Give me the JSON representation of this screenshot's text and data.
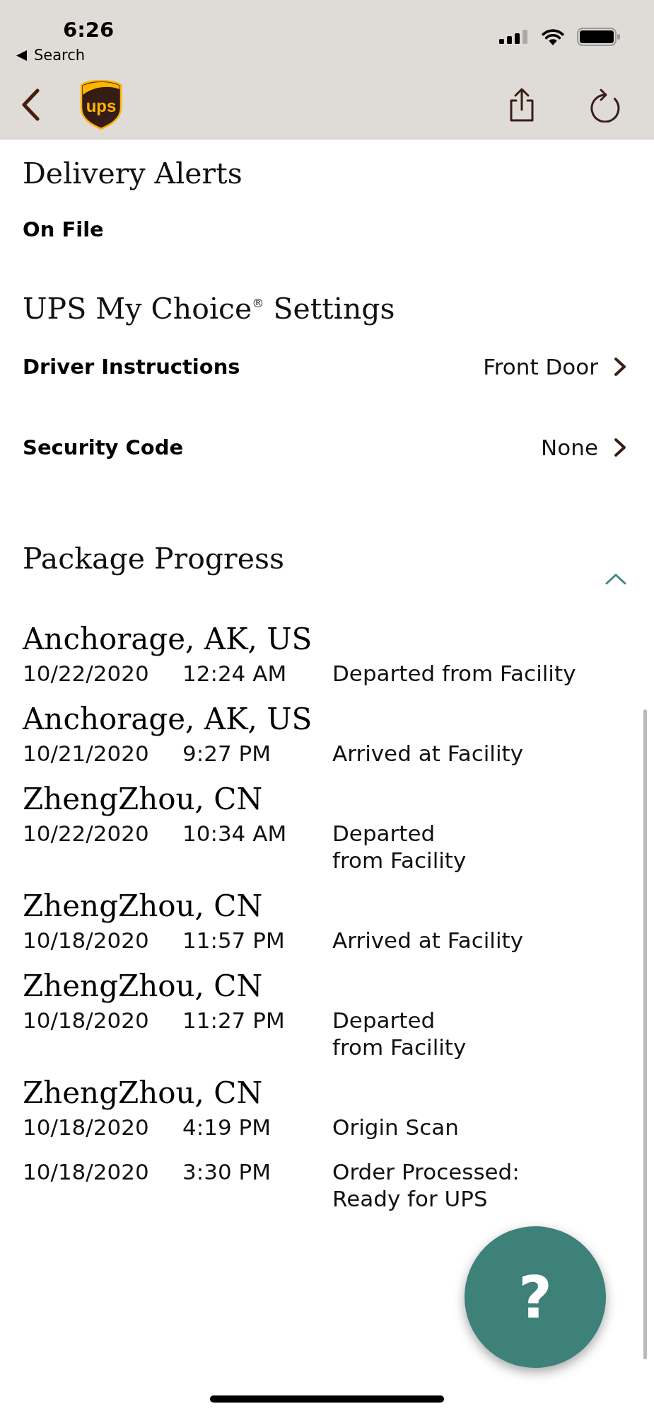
{
  "status_bar": {
    "time": "6:26",
    "back_label": "Search"
  },
  "nav_bar": {
    "logo_text": "ups"
  },
  "delivery_alerts": {
    "title": "Delivery Alerts",
    "value": "On File"
  },
  "my_choice_settings": {
    "title": "UPS My Choice$^{®}$ Settings",
    "rows": [
      {
        "label": "Driver Instructions",
        "value": "Front Door"
      },
      {
        "label": "Security Code",
        "value": "None"
      }
    ]
  },
  "package_progress": {
    "title": "Package Progress",
    "expanded": true,
    "events": [
      {
        "location": "Anchorage, AK, US",
        "date": "10/22/2020",
        "time": "12:24 AM",
        "status": "Departed from Facility"
      },
      {
        "location": "Anchorage, AK, US",
        "date": "10/21/2020",
        "time": "9:27 PM",
        "status": "Arrived at Facility"
      },
      {
        "location": "ZhengZhou, CN",
        "date": "10/22/2020",
        "time": "10:34 AM",
        "status": "Departed\nfrom Facility"
      },
      {
        "location": "ZhengZhou, CN",
        "date": "10/18/2020",
        "time": "11:57 PM",
        "status": "Arrived at Facility"
      },
      {
        "location": "ZhengZhou, CN",
        "date": "10/18/2020",
        "time": "11:27 PM",
        "status": "Departed\nfrom Facility"
      },
      {
        "location": "ZhengZhou, CN",
        "date": "10/18/2020",
        "time": "4:19 PM",
        "status": "Origin Scan"
      },
      {
        "date": "10/18/2020",
        "time": "3:30 PM",
        "status": "Order Processed:\nReady for UPS"
      }
    ]
  },
  "help_button": {
    "label": "?"
  }
}
